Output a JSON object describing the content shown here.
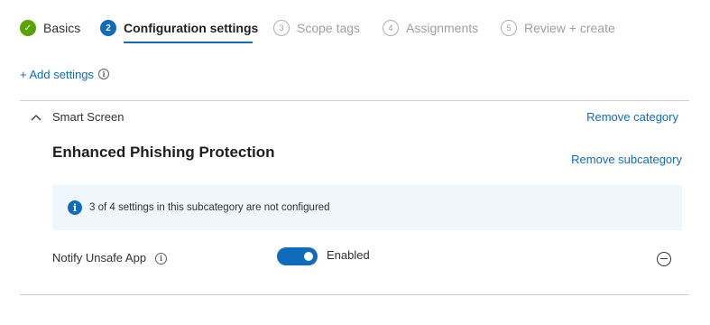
{
  "wizard": {
    "steps": [
      {
        "number": "✓",
        "label": "Basics",
        "state": "done"
      },
      {
        "number": "2",
        "label": "Configuration settings",
        "state": "current"
      },
      {
        "number": "3",
        "label": "Scope tags",
        "state": "pending"
      },
      {
        "number": "4",
        "label": "Assignments",
        "state": "pending"
      },
      {
        "number": "5",
        "label": "Review + create",
        "state": "pending"
      }
    ]
  },
  "toolbar": {
    "add_settings_label": "+ Add settings",
    "info_glyph": "i"
  },
  "category": {
    "name": "Smart Screen",
    "remove_label": "Remove category",
    "expanded": true
  },
  "subcategory": {
    "title": "Enhanced Phishing Protection",
    "remove_label": "Remove subcategory"
  },
  "banner": {
    "icon_glyph": "i",
    "text": "3 of 4 settings in this subcategory are not configured"
  },
  "setting": {
    "label": "Notify Unsafe App",
    "info_glyph": "i",
    "toggle_on": true,
    "toggle_text": "Enabled"
  },
  "colors": {
    "accent": "#0f6cbd",
    "done_green": "#57a300",
    "banner_bg": "#eff6fc"
  },
  "icons": [
    "check-icon",
    "info-icon",
    "chevron-up-icon",
    "minus-circle-icon"
  ]
}
